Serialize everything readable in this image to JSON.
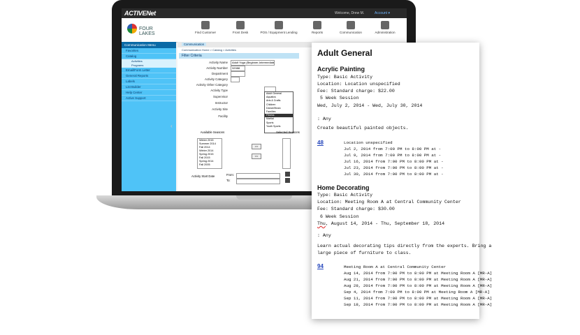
{
  "app": {
    "brand": "ACTIVENet",
    "welcome": "Welcome, Drew M.",
    "account": "Account ▾",
    "logo_text": "FOUR LAKES"
  },
  "nav": [
    {
      "label": "Find Customer",
      "icon": "customer-icon"
    },
    {
      "label": "Front Desk",
      "icon": "desk-icon"
    },
    {
      "label": "POS / Equipment Lending",
      "icon": "pos-icon"
    },
    {
      "label": "Reports",
      "icon": "reports-icon"
    },
    {
      "label": "Communication",
      "icon": "communication-icon"
    },
    {
      "label": "Administration",
      "icon": "admin-icon"
    }
  ],
  "sidebar": {
    "header": "Communication Menu",
    "items": [
      "Favorites",
      "Catalog",
      "Email/Form Letter",
      "General Reports",
      "Labels",
      "List Builder",
      "Help Center",
      "Active Support"
    ],
    "subitems": [
      "Activities",
      "Programs"
    ]
  },
  "content": {
    "tab": "Communication",
    "breadcrumb": "Communication Home > Catalog > Activities",
    "filter_header": "Filter Criteria",
    "fields": [
      {
        "label": "Activity Name",
        "value": "Adult Yoga (Beginner-Intermediate)"
      },
      {
        "label": "Activity Number",
        "value": "32088"
      },
      {
        "label": "Department",
        "value": ""
      },
      {
        "label": "Activity Category",
        "value": ""
      },
      {
        "label": "Activity Other Category",
        "value": ""
      },
      {
        "label": "Activity Type",
        "value": ""
      },
      {
        "label": "Supervisor",
        "value": ""
      },
      {
        "label": "Instructor",
        "value": ""
      },
      {
        "label": "Activity Site",
        "value": ""
      },
      {
        "label": "Facility",
        "value": ""
      }
    ],
    "category_options": [
      "Adult General",
      "Aquatics",
      "Arts & Crafts",
      "Children",
      "Dance/Music",
      "Families",
      "Fitness",
      "Martial",
      "Sports",
      "Youth Sports"
    ],
    "category_selected_index": 6,
    "available_seasons_label": "Available Seasons",
    "selected_seasons_label": "Selected Seasons",
    "seasons": [
      "Winter 2015",
      "Summer 2014",
      "Fall 2014",
      "Winter 2014",
      "Spring 2015",
      "Fall 2015",
      "Spring 2014",
      "Fall 2005"
    ],
    "start_date_label": "Activity Start Date",
    "from_label": "From:",
    "to_label": "To:",
    "add_button": ">>",
    "remove_button": "<<"
  },
  "catalog": {
    "title": "Adult General",
    "activities": [
      {
        "name": "Acrylic Painting",
        "type": "Type: Basic Activity",
        "location": "Location: Location unspecified",
        "fee": "Fee: Standard charge: $22.00",
        "session": "5 Week Session",
        "dates": "Wed, July 2, 2014 - Wed, July 30, 2014",
        "age": ":  Any",
        "description": "Create beautiful painted objects.",
        "number": "48",
        "schedule_location": "Location unspecified",
        "schedule": [
          "Jul 2, 2014 from 7:00 PM to 8:00 PM at -",
          "Jul 9, 2014 from 7:00 PM to 8:00 PM at -",
          "Jul 16, 2014 from 7:00 PM to 8:00 PM at -",
          "Jul 23, 2014 from 7:00 PM to 8:00 PM at -",
          "Jul 30, 2014 from 7:00 PM to 8:00 PM at -"
        ]
      },
      {
        "name": "Home Decorating",
        "type": "Type: Basic Activity",
        "location": "Location: Meeting Room A at Central Community Center",
        "fee": "Fee: Standard charge: $30.00",
        "session": "6 Week Session",
        "dates_prefix": "Thu",
        "dates": ", August 14, 2014 - Thu, September 18, 2014",
        "age": ":  Any",
        "description_1": "Learn actual decorating tips directly from the experts. Bring a",
        "description_2": "large piece of furniture to class.",
        "number": "94",
        "schedule_location": "Meeting Room A at Central Community Center",
        "schedule": [
          "Aug 14, 2014 from 7:00 PM to 8:00 PM at Meeting Room A [MR-A]",
          "Aug 21, 2014 from 7:00 PM to 8:00 PM at Meeting Room A [MR-A]",
          "Aug 28, 2014 from 7:00 PM to 8:00 PM at Meeting Room A [MR-A]",
          "Sep 4, 2014 from 7:00 PM to 8:00 PM at Meeting Room A [MR-A]",
          "Sep 11, 2014 from 7:00 PM to 8:00 PM at Meeting Room A [MR-A]",
          "Sep 18, 2014 from 7:00 PM to 8:00 PM at Meeting Room A [MR-A]"
        ]
      }
    ]
  }
}
